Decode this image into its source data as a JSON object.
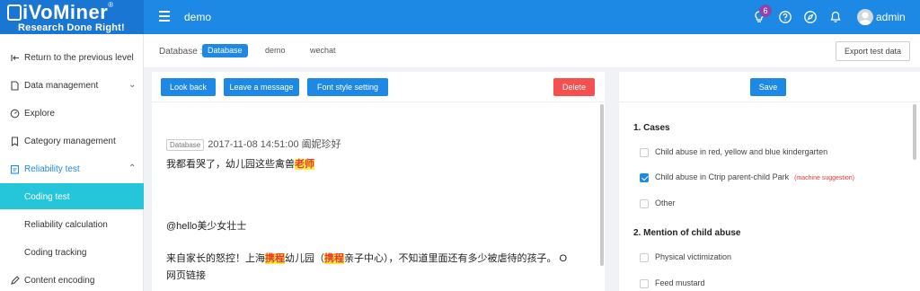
{
  "app": {
    "brand": "iVoMiner",
    "brand_reg": "®",
    "tagline": "Research Done Right!",
    "project_title": "demo",
    "notification_count": "6",
    "username": "admin"
  },
  "sidebar": {
    "items": [
      {
        "label": "Return to the previous level",
        "icon": "return-icon"
      },
      {
        "label": "Data management",
        "icon": "document-icon",
        "chevron": "⌄"
      },
      {
        "label": "Explore",
        "icon": "gauge-icon"
      },
      {
        "label": "Category management",
        "icon": "bookmark-icon"
      },
      {
        "label": "Reliability test",
        "icon": "clipboard-icon",
        "chevron": "⌃"
      },
      {
        "label": "Coding test"
      },
      {
        "label": "Reliability calculation"
      },
      {
        "label": "Coding tracking"
      },
      {
        "label": "Content encoding",
        "icon": "pen-icon"
      }
    ]
  },
  "filter": {
    "label": "Database :",
    "chips": [
      "Database",
      "demo",
      "wechat"
    ],
    "export_label": "Export test data"
  },
  "toolbar": {
    "look_back": "Look back",
    "leave_message": "Leave a message",
    "font_style": "Font style setting",
    "delete": "Delete",
    "save": "Save"
  },
  "content": {
    "tag": "Database",
    "meta": "2017-11-08 14:51:00 阖妮珍好",
    "line1_pre": "我都看哭了，幼儿园这些禽兽",
    "line1_hl": "老师",
    "line2": "@hello美少女壮士",
    "line3_a": "来自家长的怒控！上海",
    "line3_hl1": "携程",
    "line3_b": "幼儿园（",
    "line3_hl2": "携程",
    "line3_c": "亲子中心），不知道里面还有多少被虐待的孩子。 O",
    "line4": "网页链接"
  },
  "coding": {
    "q1_title": "1. Cases",
    "q1_options": [
      {
        "label": "Child abuse in red, yellow and blue kindergarten",
        "checked": false
      },
      {
        "label": "Child abuse in Ctrip parent-child Park",
        "checked": true,
        "suggestion": "(machine suggestion)"
      },
      {
        "label": "Other",
        "checked": false
      }
    ],
    "q2_title": "2. Mention of child abuse",
    "q2_options": [
      {
        "label": "Physical victimization",
        "checked": false
      },
      {
        "label": "Feed mustard",
        "checked": false
      }
    ]
  },
  "colors": {
    "primary": "#1e88e5",
    "active_sidebar": "#26c6da",
    "danger": "#f4504f",
    "highlight_bg": "#ffeb3b",
    "highlight_text": "#e53935"
  }
}
